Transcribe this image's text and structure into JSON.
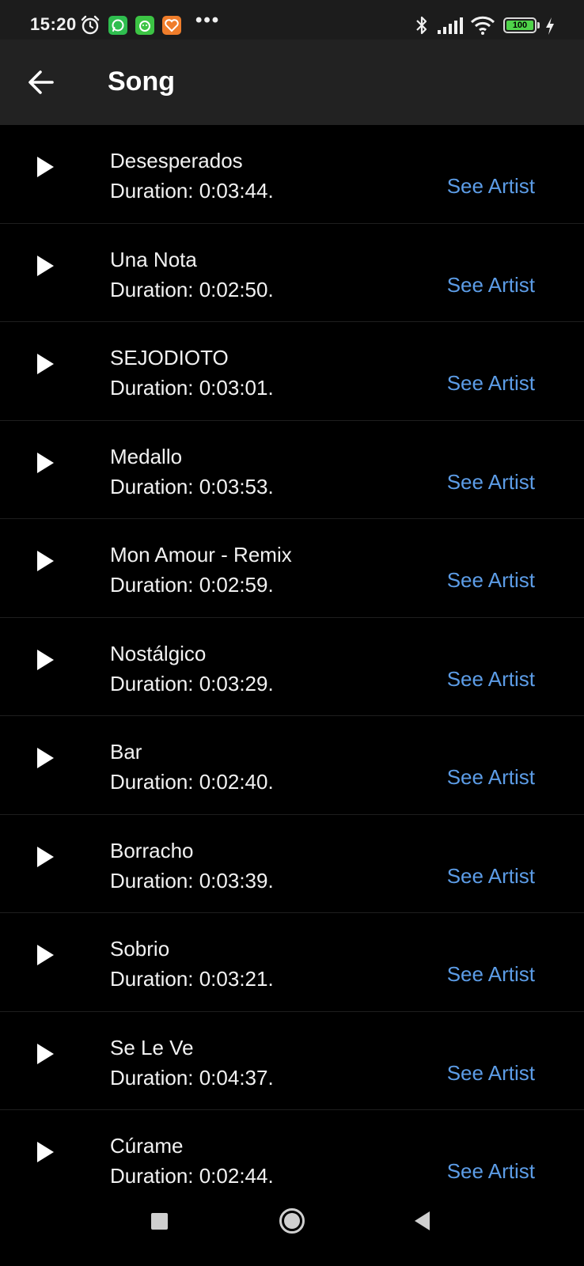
{
  "status_bar": {
    "time": "15:20",
    "battery": "100",
    "icons": [
      "alarm-icon",
      "whatsapp-icon",
      "app-icon",
      "app-icon",
      "more-icon",
      "bluetooth-icon",
      "signal-icon",
      "wifi-icon",
      "battery-icon",
      "charging-icon"
    ]
  },
  "app_bar": {
    "title": "Song",
    "back_icon": "arrow-left-icon"
  },
  "songs": [
    {
      "title": "Desesperados",
      "duration": "Duration: 0:03:44.",
      "action": "See Artist"
    },
    {
      "title": "Una Nota",
      "duration": "Duration: 0:02:50.",
      "action": "See Artist"
    },
    {
      "title": "SEJODIOTO",
      "duration": "Duration: 0:03:01.",
      "action": "See Artist"
    },
    {
      "title": "Medallo",
      "duration": "Duration: 0:03:53.",
      "action": "See Artist"
    },
    {
      "title": "Mon Amour - Remix",
      "duration": "Duration: 0:02:59.",
      "action": "See Artist"
    },
    {
      "title": "Nostálgico",
      "duration": "Duration: 0:03:29.",
      "action": "See Artist"
    },
    {
      "title": "Bar",
      "duration": "Duration: 0:02:40.",
      "action": "See Artist"
    },
    {
      "title": "Borracho",
      "duration": "Duration: 0:03:39.",
      "action": "See Artist"
    },
    {
      "title": "Sobrio",
      "duration": "Duration: 0:03:21.",
      "action": "See Artist"
    },
    {
      "title": "Se Le Ve",
      "duration": "Duration: 0:04:37.",
      "action": "See Artist"
    },
    {
      "title": "Cúrame",
      "duration": "Duration: 0:02:44.",
      "action": "See Artist"
    }
  ],
  "colors": {
    "background": "#000000",
    "app_bar": "#222222",
    "accent_link": "#5c9ce6",
    "text": "#f2f2f2"
  },
  "nav_bar": {
    "icons": [
      "recents-icon",
      "home-icon",
      "back-icon"
    ]
  }
}
